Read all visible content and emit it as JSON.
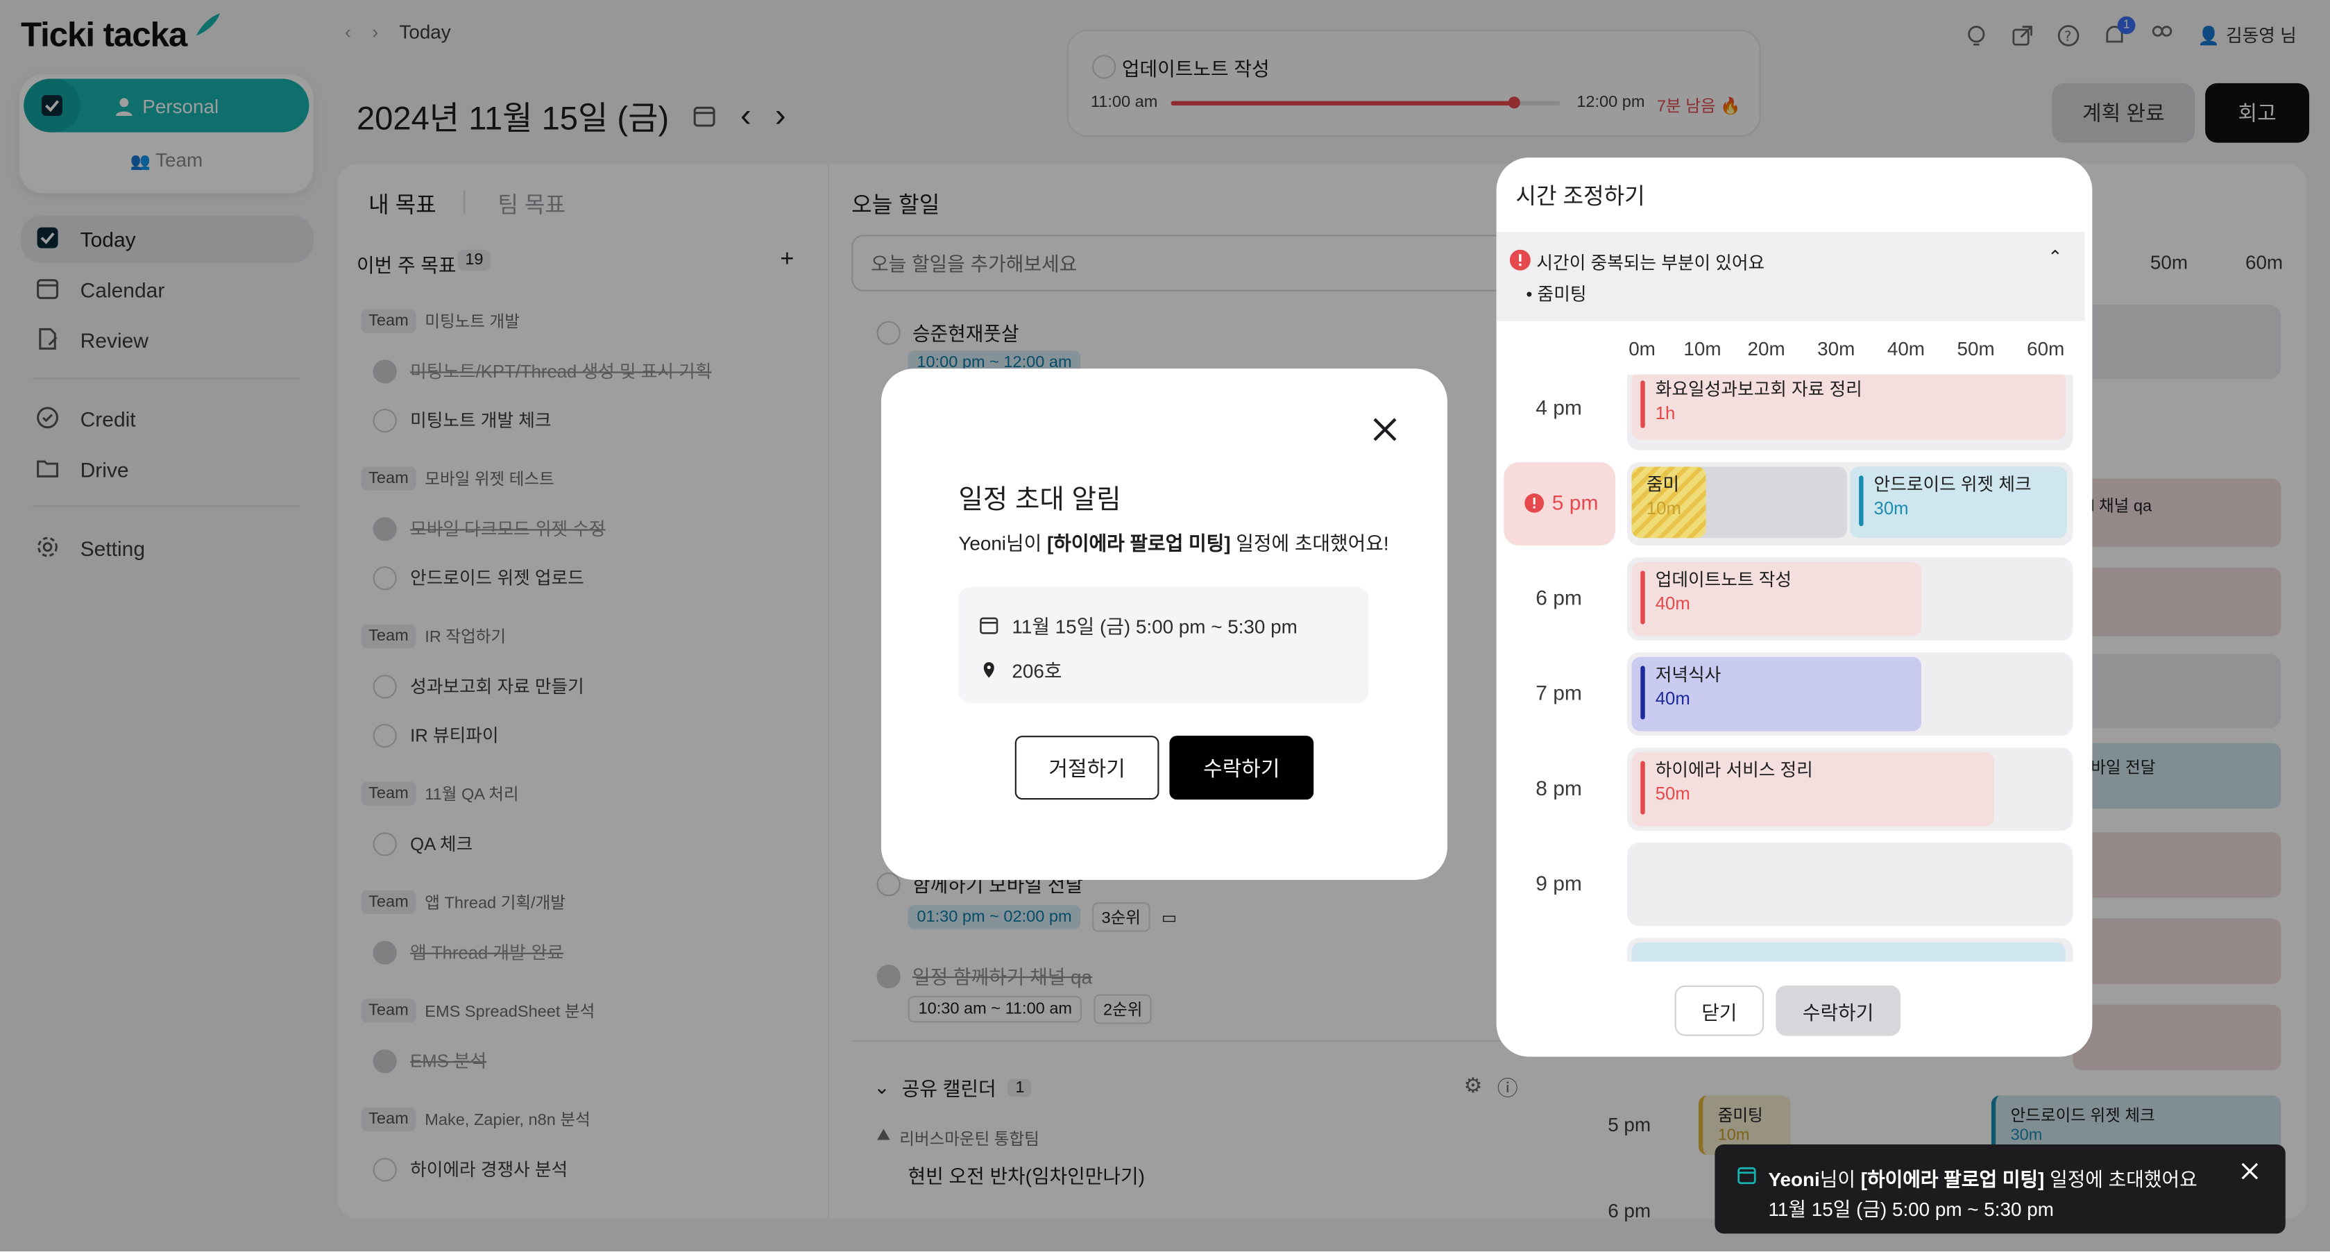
{
  "app": {
    "logo": "Ticki tacka"
  },
  "workspace": {
    "personal": "Personal",
    "team": "Team"
  },
  "sidebar": {
    "items": [
      {
        "label": "Today",
        "icon": "check-square-icon"
      },
      {
        "label": "Calendar",
        "icon": "calendar-icon"
      },
      {
        "label": "Review",
        "icon": "review-doc-icon"
      },
      {
        "label": "Credit",
        "icon": "credit-check-icon"
      },
      {
        "label": "Drive",
        "icon": "folder-icon"
      },
      {
        "label": "Setting",
        "icon": "gear-icon"
      }
    ]
  },
  "header": {
    "breadcrumb": "Today",
    "date": "2024년 11월 15일 (금)",
    "user": "김동영 님",
    "notification_count": "1",
    "plan_done": "계획 완료",
    "retro": "회고"
  },
  "timer": {
    "task": "업데이트노트 작성",
    "start": "11:00 am",
    "end": "12:00 pm",
    "remaining": "7분 남음 🔥",
    "progress": 0.88,
    "accent": "#e5484d"
  },
  "goals": {
    "tab_mine": "내 목표",
    "tab_team": "팀 목표",
    "week_title": "이번 주 목표",
    "count": "19",
    "team_tag": "Team",
    "groups": [
      {
        "name": "미팅노트 개발",
        "items": [
          {
            "text": "미팅노트/KPT/Thread 생성 및 표시 기획",
            "done": true
          },
          {
            "text": "미팅노트 개발 체크",
            "done": false
          }
        ]
      },
      {
        "name": "모바일 위젯 테스트",
        "items": [
          {
            "text": "모바일 다크모드 위젯 수정",
            "done": true
          },
          {
            "text": "안드로이드 위젯 업로드",
            "done": false
          }
        ]
      },
      {
        "name": "IR 작업하기",
        "items": [
          {
            "text": "성과보고회 자료 만들기",
            "done": false
          },
          {
            "text": "IR 뷰티파이",
            "done": false
          }
        ]
      },
      {
        "name": "11월 QA 처리",
        "items": [
          {
            "text": "QA 체크",
            "done": false
          }
        ]
      },
      {
        "name": "앱 Thread 기획/개발",
        "items": [
          {
            "text": "앱 Thread 개발 완료",
            "done": true
          }
        ]
      },
      {
        "name": "EMS SpreadSheet 분석",
        "items": [
          {
            "text": "EMS 분석",
            "done": true
          }
        ]
      },
      {
        "name": "Make, Zapier, n8n 분석",
        "items": [
          {
            "text": "하이에라 경쟁사 분석",
            "done": false
          }
        ]
      }
    ]
  },
  "todos": {
    "title": "오늘 할일",
    "placeholder": "오늘 할일을 추가해보세요",
    "items": [
      {
        "text": "승준현재풋살",
        "time": "10:00 pm ~ 12:00 am"
      },
      {
        "text": "함께하기 모바일 전달",
        "time": "01:30 pm ~ 02:00 pm",
        "rank": "3순위"
      },
      {
        "text": "일정 함께하기 채널 qa",
        "time": "10:30 am ~ 11:00 am",
        "rank": "2순위"
      }
    ],
    "shared_title": "공유 캘린더",
    "shared_count": "1",
    "shared_team": "리버스마운틴 통합팀",
    "shared_event": "현빈 오전 반차(임차인만나기)"
  },
  "background_timeline": {
    "cols": [
      "50m",
      "60m"
    ],
    "hours": [
      "5 pm",
      "6 pm"
    ],
    "events": [
      {
        "label": "줌미팅",
        "dur": "10m"
      },
      {
        "label": "안드로이드 위젯 체크",
        "dur": "30m"
      },
      {
        "label": "l 채널 qa"
      },
      {
        "label": "바일 전달"
      }
    ]
  },
  "invite": {
    "title": "일정 초대 알림",
    "msg_pre": "Yeoni님이 ",
    "msg_bold": "[하이에라 팔로업 미팅]",
    "msg_post": " 일정에 초대했어요!",
    "when": "11월 15일 (금) 5:00 pm ~ 5:30 pm",
    "where": "206호",
    "decline": "거절하기",
    "accept": "수락하기"
  },
  "time_adjust": {
    "title": "시간 조정하기",
    "warning": "시간이 중복되는 부분이 있어요",
    "conflict": "• 줌미팅",
    "cols": [
      "0m",
      "10m",
      "20m",
      "30m",
      "40m",
      "50m",
      "60m"
    ],
    "hours": [
      "4 pm",
      "5 pm",
      "6 pm",
      "7 pm",
      "8 pm",
      "9 pm"
    ],
    "events": [
      {
        "label": "화요일성과보고회 자료 정리",
        "dur": "1h"
      },
      {
        "label": "줌미",
        "dur": "10m"
      },
      {
        "label": "안드로이드 위젯 체크",
        "dur": "30m"
      },
      {
        "label": "업데이트노트 작성",
        "dur": "40m"
      },
      {
        "label": "저녁식사",
        "dur": "40m"
      },
      {
        "label": "하이에라 서비스 정리",
        "dur": "50m"
      }
    ],
    "close": "닫기",
    "accept": "수락하기"
  },
  "toast": {
    "bold_pre": "Yeoni",
    "pre": "님이 ",
    "bold": "[하이에라 팔로업 미팅]",
    "post": " 일정에 초대했어요",
    "line2": "11월 15일 (금) 5:00 pm ~ 5:30 pm"
  },
  "colors": {
    "teal": "#17b3b0",
    "red": "#e5484d",
    "pink_bg": "#f4dede",
    "blue_bg": "#cfe6ee",
    "purple_bg": "#c9cbf0",
    "navy": "#1e2a9c"
  }
}
